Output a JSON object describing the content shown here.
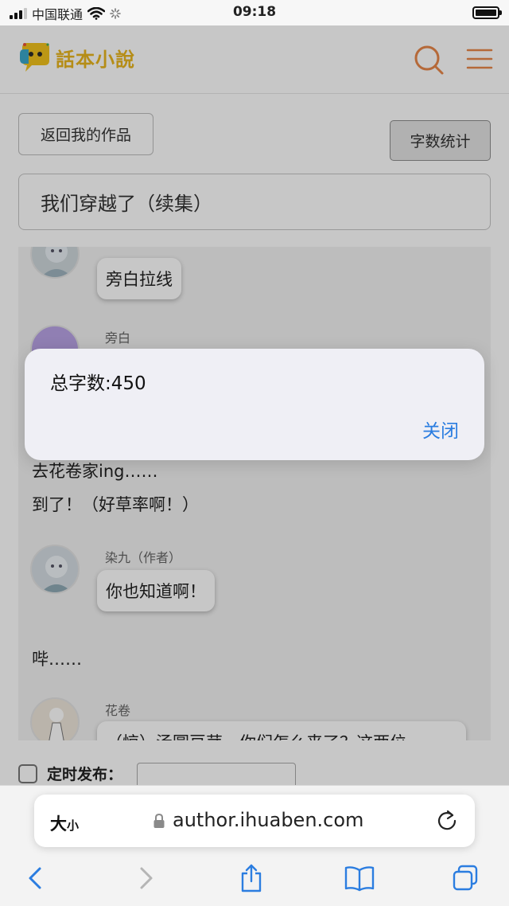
{
  "status_bar": {
    "carrier": "中国联通",
    "time": "09:18"
  },
  "header": {
    "logo_text": "話本小說",
    "logo_color": "#e8b51e",
    "accent_color": "#e8874a"
  },
  "toolbar": {
    "back_label": "返回我的作品",
    "count_label": "字数统计"
  },
  "work_title": "我们穿越了（续集）",
  "messages": {
    "m1_text": "旁白拉线",
    "m2_author": "旁白",
    "n1_text": "去花卷家ing……",
    "n2_text": "到了！（好草率啊！）",
    "m3_author": "染九（作者）",
    "m3_text": "你也知道啊！",
    "n3_text": "哔……",
    "m4_author": "花卷",
    "m4_text": "（惊）汤圆豆芽，你们怎么来了？这两位"
  },
  "schedule": {
    "label": "定时发布："
  },
  "alert": {
    "message": "总字数:450",
    "close_label": "关闭"
  },
  "browser": {
    "text_size_big": "大",
    "text_size_small": "小",
    "url": "author.ihuaben.com"
  }
}
